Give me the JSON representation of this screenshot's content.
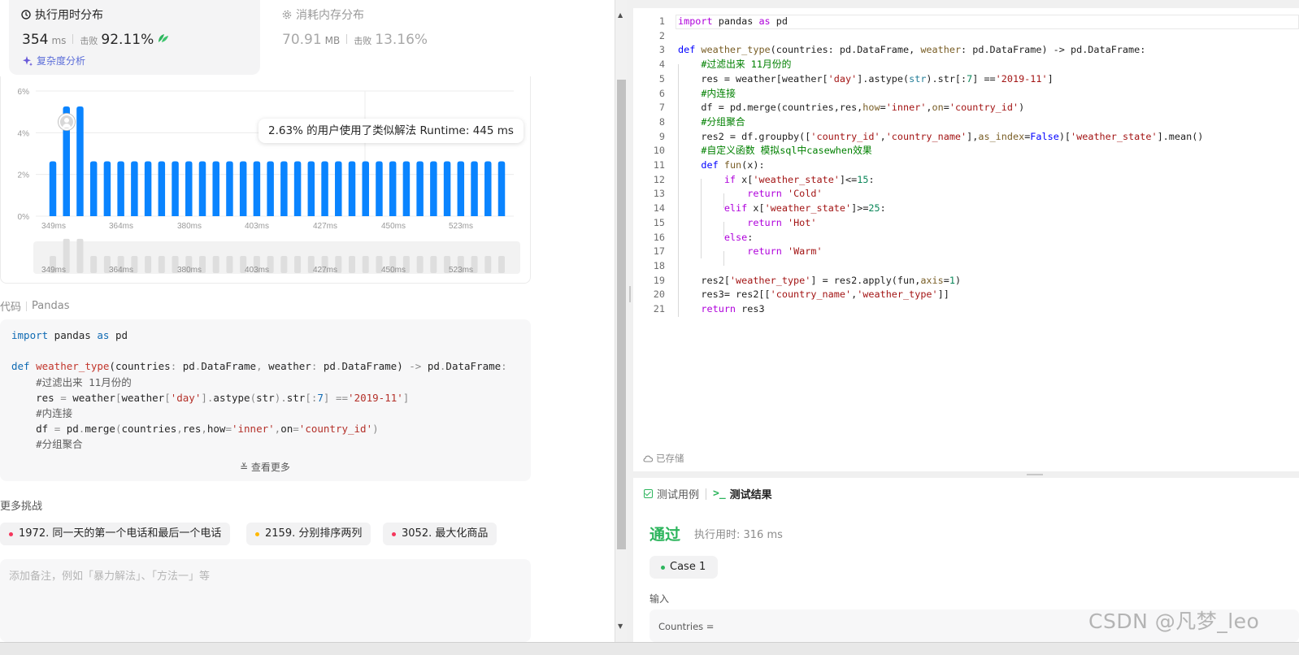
{
  "stats": {
    "runtime": {
      "title": "执行用时分布",
      "value": "354",
      "unit": "ms",
      "beats_label": "击败",
      "beats_value": "92.11%"
    },
    "memory": {
      "title": "消耗内存分布",
      "value": "70.91",
      "unit": "MB",
      "beats_label": "击败",
      "beats_value": "13.16%"
    },
    "analysis_link": "复杂度分析"
  },
  "tooltip": "2.63% 的用户使用了类似解法 Runtime: 445 ms",
  "chart_data": {
    "type": "bar",
    "y_ticks": [
      "6%",
      "4%",
      "2%",
      "0%"
    ],
    "ylim": [
      0,
      6
    ],
    "x_ticks": [
      "349ms",
      "364ms",
      "380ms",
      "403ms",
      "427ms",
      "450ms",
      "523ms"
    ],
    "values": [
      2.63,
      5.26,
      5.26,
      2.63,
      2.63,
      2.63,
      2.63,
      2.63,
      2.63,
      2.63,
      2.63,
      2.63,
      2.63,
      2.63,
      2.63,
      2.63,
      2.63,
      2.63,
      2.63,
      2.63,
      2.63,
      2.63,
      2.63,
      2.63,
      2.63,
      2.63,
      2.63,
      2.63,
      2.63,
      2.63,
      2.63,
      2.63,
      2.63,
      2.63
    ],
    "bar_color": "#0a84ff",
    "grid": true
  },
  "code_header": {
    "label": "代码",
    "lang": "Pandas"
  },
  "code_preview": [
    [
      {
        "t": "import",
        "c": "ckw"
      },
      {
        "t": " pandas ",
        "c": ""
      },
      {
        "t": "as",
        "c": "ckw"
      },
      {
        "t": " pd",
        "c": ""
      }
    ],
    [],
    [
      {
        "t": "def ",
        "c": "ckw"
      },
      {
        "t": "weather_type",
        "c": "cfn"
      },
      {
        "t": "(countries",
        "c": ""
      },
      {
        "t": ":",
        "c": "cp"
      },
      {
        "t": " pd",
        "c": ""
      },
      {
        "t": ".",
        "c": "cp"
      },
      {
        "t": "DataFrame",
        "c": ""
      },
      {
        "t": ",",
        "c": "cp"
      },
      {
        "t": " weather",
        "c": ""
      },
      {
        "t": ":",
        "c": "cp"
      },
      {
        "t": " pd",
        "c": ""
      },
      {
        "t": ".",
        "c": "cp"
      },
      {
        "t": "DataFrame",
        "c": ""
      },
      {
        "t": ")",
        "c": ""
      },
      {
        "t": " -> ",
        "c": "cp"
      },
      {
        "t": "pd",
        "c": ""
      },
      {
        "t": ".",
        "c": "cp"
      },
      {
        "t": "DataFrame",
        "c": ""
      },
      {
        "t": ":",
        "c": "cp"
      }
    ],
    [
      {
        "t": "    #过滤出来 11月份的",
        "c": "ccm"
      }
    ],
    [
      {
        "t": "    res ",
        "c": ""
      },
      {
        "t": "=",
        "c": "cp"
      },
      {
        "t": " weather",
        "c": ""
      },
      {
        "t": "[",
        "c": "cp"
      },
      {
        "t": "weather",
        "c": ""
      },
      {
        "t": "[",
        "c": "cp"
      },
      {
        "t": "'day'",
        "c": "cstr"
      },
      {
        "t": "].",
        "c": "cp"
      },
      {
        "t": "astype",
        "c": ""
      },
      {
        "t": "(",
        "c": "cp"
      },
      {
        "t": "str",
        "c": ""
      },
      {
        "t": ").",
        "c": "cp"
      },
      {
        "t": "str",
        "c": ""
      },
      {
        "t": "[:",
        "c": "cp"
      },
      {
        "t": "7",
        "c": "cnum"
      },
      {
        "t": "] ",
        "c": "cp"
      },
      {
        "t": "==",
        "c": "cp"
      },
      {
        "t": "'2019-11'",
        "c": "cstr"
      },
      {
        "t": "]",
        "c": "cp"
      }
    ],
    [
      {
        "t": "    #内连接",
        "c": "ccm"
      }
    ],
    [
      {
        "t": "    df ",
        "c": ""
      },
      {
        "t": "=",
        "c": "cp"
      },
      {
        "t": " pd",
        "c": ""
      },
      {
        "t": ".",
        "c": "cp"
      },
      {
        "t": "merge",
        "c": ""
      },
      {
        "t": "(",
        "c": "cp"
      },
      {
        "t": "countries",
        "c": ""
      },
      {
        "t": ",",
        "c": "cp"
      },
      {
        "t": "res",
        "c": ""
      },
      {
        "t": ",",
        "c": "cp"
      },
      {
        "t": "how",
        "c": ""
      },
      {
        "t": "=",
        "c": "cp"
      },
      {
        "t": "'inner'",
        "c": "cstr"
      },
      {
        "t": ",",
        "c": "cp"
      },
      {
        "t": "on",
        "c": ""
      },
      {
        "t": "=",
        "c": "cp"
      },
      {
        "t": "'country_id'",
        "c": "cstr"
      },
      {
        "t": ")",
        "c": "cp"
      }
    ],
    [
      {
        "t": "    #分组聚合",
        "c": "ccm"
      }
    ]
  ],
  "see_more": "查看更多",
  "more_challenges": {
    "title": "更多挑战",
    "items": [
      {
        "label": "1972. 同一天的第一个电话和最后一个电话",
        "color": "#f5365c"
      },
      {
        "label": "2159. 分别排序两列",
        "color": "#ffb800"
      },
      {
        "label": "3052. 最大化商品",
        "color": "#f5365c"
      }
    ]
  },
  "note_placeholder": "添加备注，例如「暴力解法」、「方法一」等",
  "editor": {
    "lines": [
      [
        {
          "t": "import",
          "c": "kw2"
        },
        {
          "t": " pandas ",
          "c": ""
        },
        {
          "t": "as",
          "c": "kw2"
        },
        {
          "t": " pd",
          "c": ""
        }
      ],
      [],
      [
        {
          "t": "def",
          "c": "kw"
        },
        {
          "t": " ",
          "c": ""
        },
        {
          "t": "weather_type",
          "c": "fn"
        },
        {
          "t": "(countries: pd.DataFrame, ",
          "c": ""
        },
        {
          "t": "weather",
          "c": "fn"
        },
        {
          "t": ": pd.DataFrame) -> pd.DataFrame:",
          "c": ""
        }
      ],
      [
        {
          "t": "    #过滤出来 11月份的",
          "c": "cm"
        }
      ],
      [
        {
          "t": "    res = weather[weather[",
          "c": ""
        },
        {
          "t": "'day'",
          "c": "str"
        },
        {
          "t": "].astype(",
          "c": ""
        },
        {
          "t": "str",
          "c": "ty"
        },
        {
          "t": ").str[:",
          "c": ""
        },
        {
          "t": "7",
          "c": "num"
        },
        {
          "t": "] ==",
          "c": ""
        },
        {
          "t": "'2019-11'",
          "c": "str"
        },
        {
          "t": "]",
          "c": ""
        }
      ],
      [
        {
          "t": "    #内连接",
          "c": "cm"
        }
      ],
      [
        {
          "t": "    df = pd.merge(countries,res,",
          "c": ""
        },
        {
          "t": "how",
          "c": "fn"
        },
        {
          "t": "=",
          "c": ""
        },
        {
          "t": "'inner'",
          "c": "str"
        },
        {
          "t": ",",
          "c": ""
        },
        {
          "t": "on",
          "c": "fn"
        },
        {
          "t": "=",
          "c": ""
        },
        {
          "t": "'country_id'",
          "c": "str"
        },
        {
          "t": ")",
          "c": ""
        }
      ],
      [
        {
          "t": "    #分组聚合",
          "c": "cm"
        }
      ],
      [
        {
          "t": "    res2 = df.groupby([",
          "c": ""
        },
        {
          "t": "'country_id'",
          "c": "str"
        },
        {
          "t": ",",
          "c": ""
        },
        {
          "t": "'country_name'",
          "c": "str"
        },
        {
          "t": "],",
          "c": ""
        },
        {
          "t": "as_index",
          "c": "fn"
        },
        {
          "t": "=",
          "c": ""
        },
        {
          "t": "False",
          "c": "kw"
        },
        {
          "t": ")[",
          "c": ""
        },
        {
          "t": "'weather_state'",
          "c": "str"
        },
        {
          "t": "].mean()",
          "c": ""
        }
      ],
      [
        {
          "t": "    #自定义函数 模拟sql中casewhen效果",
          "c": "cm"
        }
      ],
      [
        {
          "t": "    ",
          "c": ""
        },
        {
          "t": "def",
          "c": "kw"
        },
        {
          "t": " ",
          "c": ""
        },
        {
          "t": "fun",
          "c": "fn"
        },
        {
          "t": "(x):",
          "c": ""
        }
      ],
      [
        {
          "t": "        ",
          "c": ""
        },
        {
          "t": "if",
          "c": "kw2"
        },
        {
          "t": " x[",
          "c": ""
        },
        {
          "t": "'weather_state'",
          "c": "str"
        },
        {
          "t": "]<=",
          "c": ""
        },
        {
          "t": "15",
          "c": "num"
        },
        {
          "t": ":",
          "c": ""
        }
      ],
      [
        {
          "t": "            ",
          "c": ""
        },
        {
          "t": "return",
          "c": "kw2"
        },
        {
          "t": " ",
          "c": ""
        },
        {
          "t": "'Cold'",
          "c": "str"
        }
      ],
      [
        {
          "t": "        ",
          "c": ""
        },
        {
          "t": "elif",
          "c": "kw2"
        },
        {
          "t": " x[",
          "c": ""
        },
        {
          "t": "'weather_state'",
          "c": "str"
        },
        {
          "t": "]>=",
          "c": ""
        },
        {
          "t": "25",
          "c": "num"
        },
        {
          "t": ":",
          "c": ""
        }
      ],
      [
        {
          "t": "            ",
          "c": ""
        },
        {
          "t": "return",
          "c": "kw2"
        },
        {
          "t": " ",
          "c": ""
        },
        {
          "t": "'Hot'",
          "c": "str"
        }
      ],
      [
        {
          "t": "        ",
          "c": ""
        },
        {
          "t": "else",
          "c": "kw2"
        },
        {
          "t": ":",
          "c": ""
        }
      ],
      [
        {
          "t": "            ",
          "c": ""
        },
        {
          "t": "return",
          "c": "kw2"
        },
        {
          "t": " ",
          "c": ""
        },
        {
          "t": "'Warm'",
          "c": "str"
        }
      ],
      [],
      [
        {
          "t": "    res2[",
          "c": ""
        },
        {
          "t": "'weather_type'",
          "c": "str"
        },
        {
          "t": "] = res2.apply(fun,",
          "c": ""
        },
        {
          "t": "axis",
          "c": "fn"
        },
        {
          "t": "=",
          "c": ""
        },
        {
          "t": "1",
          "c": "num"
        },
        {
          "t": ")",
          "c": ""
        }
      ],
      [
        {
          "t": "    res3= res2[[",
          "c": ""
        },
        {
          "t": "'country_name'",
          "c": "str"
        },
        {
          "t": ",",
          "c": ""
        },
        {
          "t": "'weather_type'",
          "c": "str"
        },
        {
          "t": "]]",
          "c": ""
        }
      ],
      [
        {
          "t": "    ",
          "c": ""
        },
        {
          "t": "return",
          "c": "kw2"
        },
        {
          "t": " res3",
          "c": ""
        }
      ]
    ],
    "saved_label": "已存储"
  },
  "result": {
    "tabs": [
      {
        "label": "测试用例",
        "icon": "checkbox-icon"
      },
      {
        "label": "测试结果",
        "icon": "terminal-prompt-icon"
      }
    ],
    "status": "通过",
    "exec_time": "执行用时: 316 ms",
    "case_label": "Case 1",
    "input_label": "输入",
    "input_preview": "Countries ="
  },
  "watermark": "CSDN @凡梦_leo"
}
